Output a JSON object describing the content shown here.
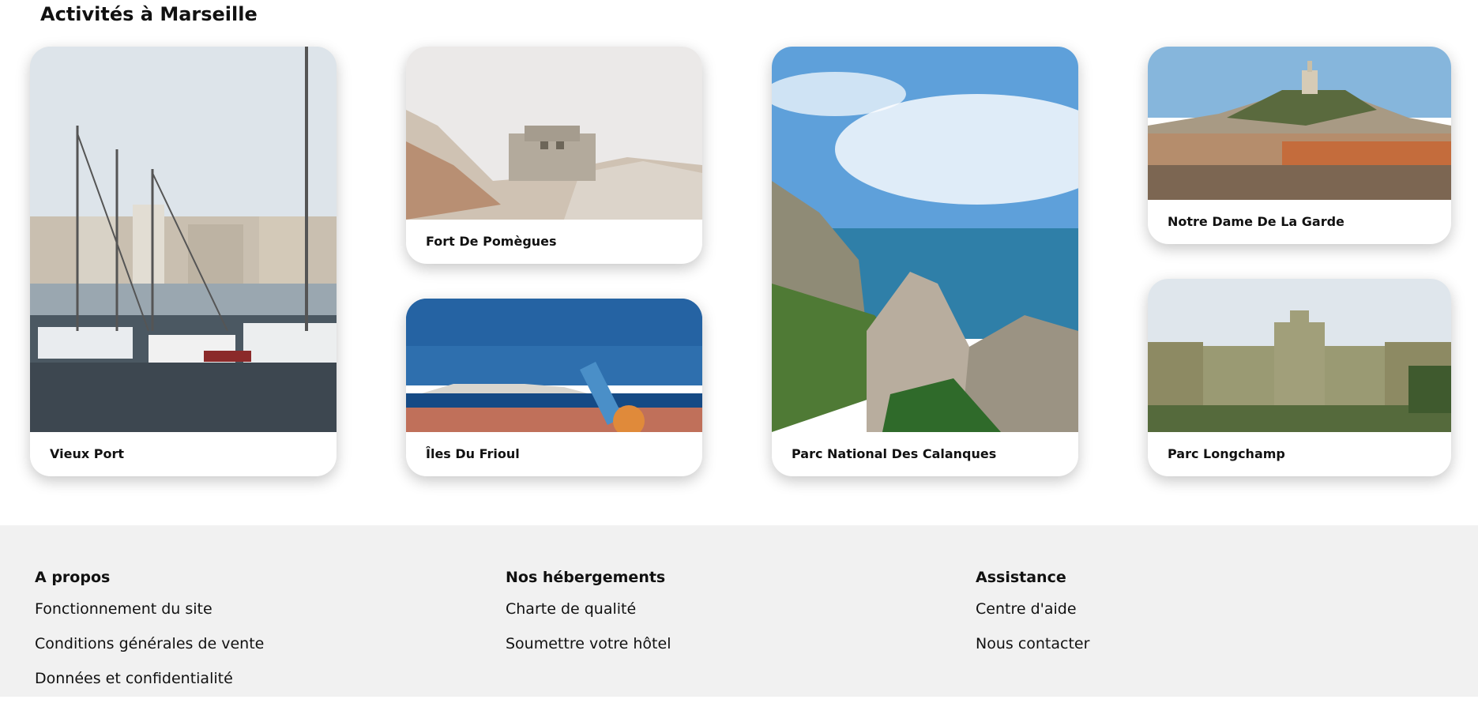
{
  "section_title": "Activités à Marseille",
  "activities": [
    {
      "id": "c1",
      "label": "Vieux Port",
      "image": "harbor-sailboats-photo"
    },
    {
      "id": "c2",
      "label": "Fort De Pomègues",
      "image": "stone-fort-on-rocks-photo"
    },
    {
      "id": "c3",
      "label": "Îles Du Frioul",
      "image": "islands-sea-telescope-photo"
    },
    {
      "id": "c4",
      "label": "Parc National Des Calanques",
      "image": "calanques-cliffs-sea-photo"
    },
    {
      "id": "c5",
      "label": "Notre Dame De La Garde",
      "image": "basilica-on-hill-city-photo"
    },
    {
      "id": "c6",
      "label": "Parc Longchamp",
      "image": "palais-longchamp-colonnade-photo"
    }
  ],
  "footer": {
    "about": {
      "title": "A propos",
      "links": [
        "Fonctionnement du site",
        "Conditions générales de vente",
        "Données et confidentialité"
      ]
    },
    "hotels": {
      "title": "Nos hébergements",
      "links": [
        "Charte de qualité",
        "Soumettre votre hôtel"
      ]
    },
    "help": {
      "title": "Assistance",
      "links": [
        "Centre d'aide",
        "Nous contacter"
      ]
    }
  }
}
